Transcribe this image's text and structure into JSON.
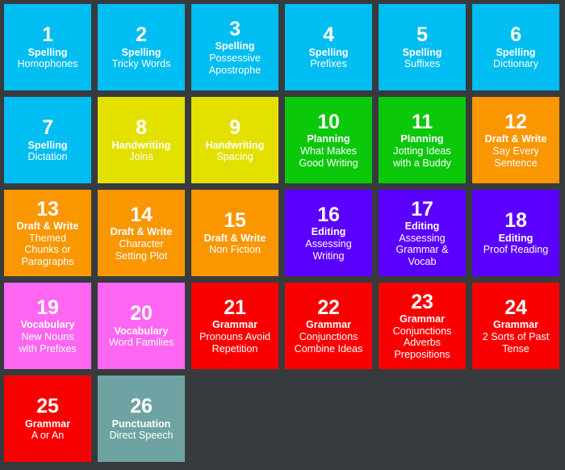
{
  "board": {
    "background_color": "#373b3e",
    "columns": 6,
    "palette": {
      "blue": "#00bdf2",
      "yellow": "#e3e000",
      "green": "#0bc80b",
      "orange": "#fa9600",
      "purple": "#5a00ff",
      "pink": "#ff66f2",
      "red": "#f80000",
      "teal": "#6fa3a3"
    },
    "tiles": [
      {
        "number": "1",
        "category": "Spelling",
        "subtitle": [
          "Homophones"
        ],
        "color": "#00bdf2"
      },
      {
        "number": "2",
        "category": "Spelling",
        "subtitle": [
          "Tricky Words"
        ],
        "color": "#00bdf2"
      },
      {
        "number": "3",
        "category": "Spelling",
        "subtitle": [
          "Possessive",
          "Apostrophe"
        ],
        "color": "#00bdf2"
      },
      {
        "number": "4",
        "category": "Spelling",
        "subtitle": [
          "Prefixes"
        ],
        "color": "#00bdf2"
      },
      {
        "number": "5",
        "category": "Spelling",
        "subtitle": [
          "Suffixes"
        ],
        "color": "#00bdf2"
      },
      {
        "number": "6",
        "category": "Spelling",
        "subtitle": [
          "Dictionary"
        ],
        "color": "#00bdf2"
      },
      {
        "number": "7",
        "category": "Spelling",
        "subtitle": [
          "Dictation"
        ],
        "color": "#00bdf2"
      },
      {
        "number": "8",
        "category": "Handwriting",
        "subtitle": [
          "Joins"
        ],
        "color": "#e3e000"
      },
      {
        "number": "9",
        "category": "Handwriting",
        "subtitle": [
          "Spacing"
        ],
        "color": "#e3e000"
      },
      {
        "number": "10",
        "category": "Planning",
        "subtitle": [
          "What Makes",
          "Good Writing"
        ],
        "color": "#0bc80b"
      },
      {
        "number": "11",
        "category": "Planning",
        "subtitle": [
          "Jotting Ideas",
          "with a Buddy"
        ],
        "color": "#0bc80b"
      },
      {
        "number": "12",
        "category": "Draft & Write",
        "subtitle": [
          "Say Every",
          "Sentence"
        ],
        "color": "#fa9600"
      },
      {
        "number": "13",
        "category": "Draft & Write",
        "subtitle": [
          "Themed",
          "Chunks or",
          "Paragraphs"
        ],
        "color": "#fa9600"
      },
      {
        "number": "14",
        "category": "Draft & Write",
        "subtitle": [
          "Character",
          "Setting Plot"
        ],
        "color": "#fa9600"
      },
      {
        "number": "15",
        "category": "Draft & Write",
        "subtitle": [
          "Non Fiction"
        ],
        "color": "#fa9600"
      },
      {
        "number": "16",
        "category": "Editing",
        "subtitle": [
          "Assessing",
          "Writing"
        ],
        "color": "#5a00ff"
      },
      {
        "number": "17",
        "category": "Editing",
        "subtitle": [
          "Assessing",
          "Grammar &",
          "Vocab"
        ],
        "color": "#5a00ff"
      },
      {
        "number": "18",
        "category": "Editing",
        "subtitle": [
          "Proof Reading"
        ],
        "color": "#5a00ff"
      },
      {
        "number": "19",
        "category": "Vocabulary",
        "subtitle": [
          "New Nouns",
          "with Prefixes"
        ],
        "color": "#ff66f2"
      },
      {
        "number": "20",
        "category": "Vocabulary",
        "subtitle": [
          "Word Families"
        ],
        "color": "#ff66f2"
      },
      {
        "number": "21",
        "category": "Grammar",
        "subtitle": [
          "Pronouns Avoid",
          "Repetition"
        ],
        "color": "#f80000"
      },
      {
        "number": "22",
        "category": "Grammar",
        "subtitle": [
          "Conjunctions",
          "Combine Ideas"
        ],
        "color": "#f80000"
      },
      {
        "number": "23",
        "category": "Grammar",
        "subtitle": [
          "Conjunctions",
          "Adverbs",
          "Prepositions"
        ],
        "color": "#f80000"
      },
      {
        "number": "24",
        "category": "Grammar",
        "subtitle": [
          "2 Sorts of Past",
          "Tense"
        ],
        "color": "#f80000"
      },
      {
        "number": "25",
        "category": "Grammar",
        "subtitle": [
          "A or An"
        ],
        "color": "#f80000"
      },
      {
        "number": "26",
        "category": "Punctuation",
        "subtitle": [
          "Direct Speech"
        ],
        "color": "#6fa3a3"
      }
    ]
  }
}
